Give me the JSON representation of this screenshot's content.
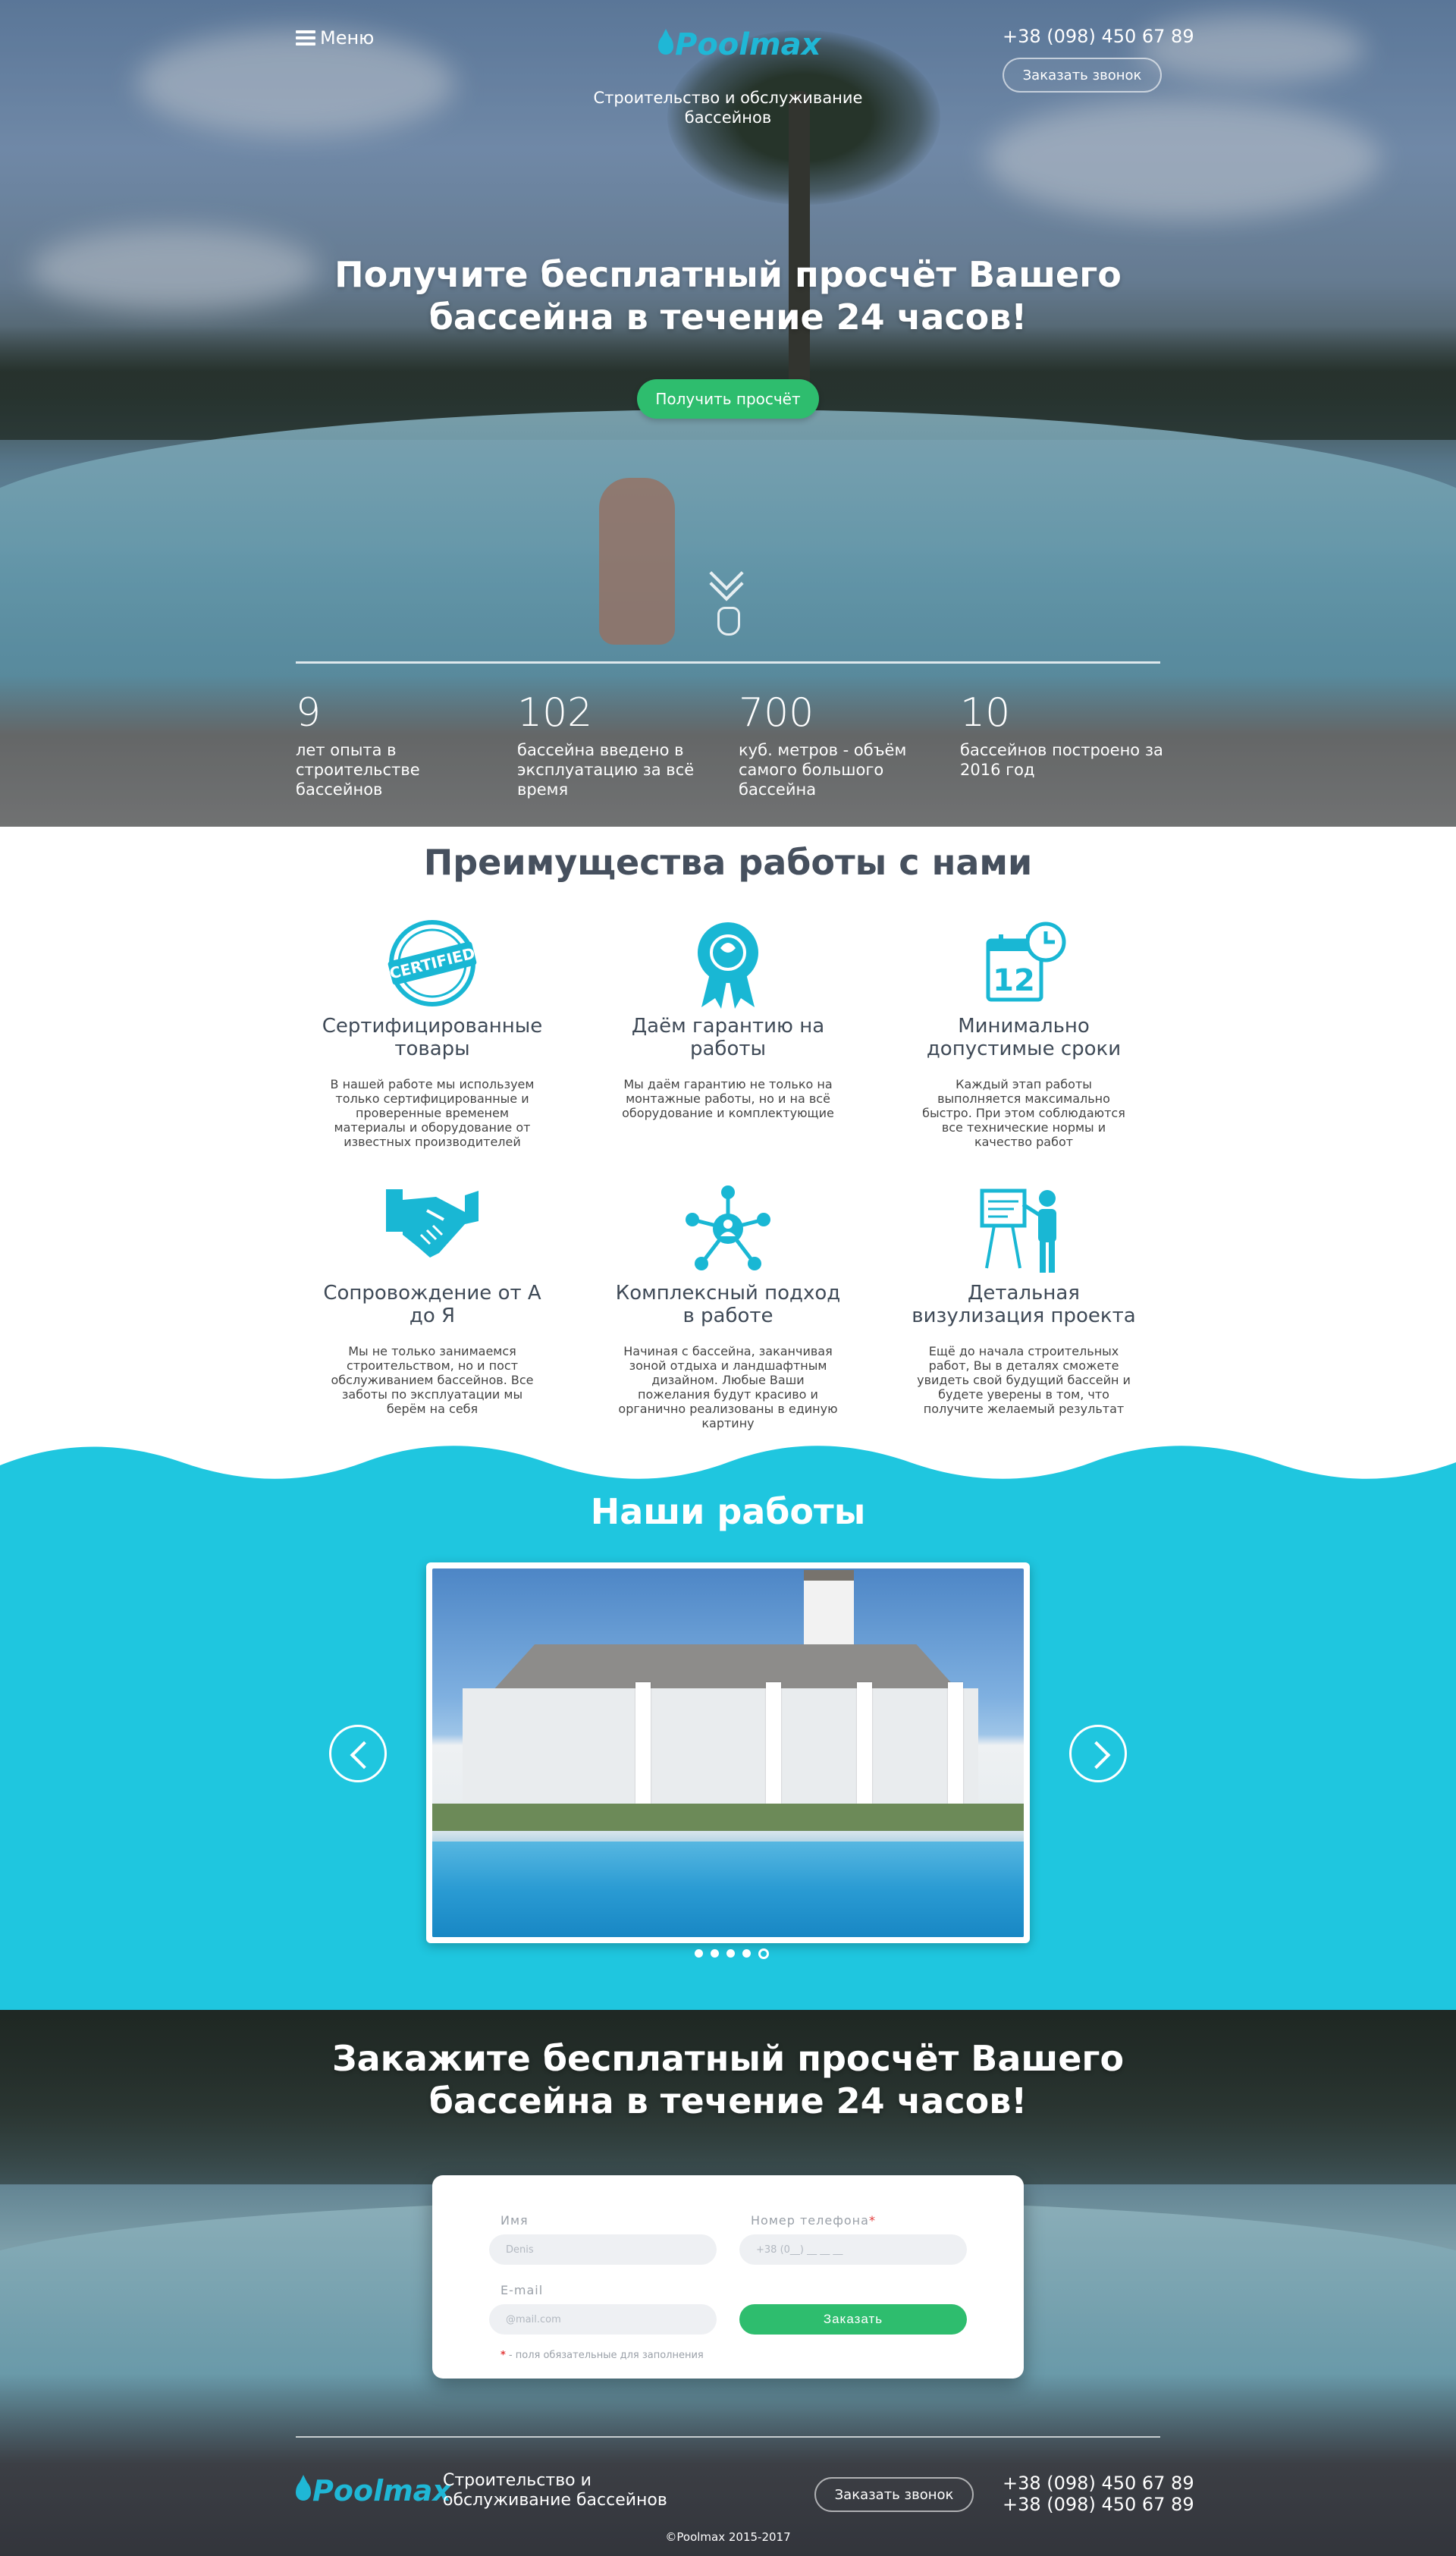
{
  "header": {
    "menu_label": "Меню",
    "logo": "Poolmax",
    "tagline": "Строительство и обслуживание бассейнов",
    "phone": "+38 (098) 450 67 89",
    "callback_label": "Заказать звонок"
  },
  "hero": {
    "title_p1": "Получите ",
    "title_b1": "бесплатный",
    "title_p2": " просчёт Вашего ",
    "title_b2": "бассейна",
    "title_p3": " в течение ",
    "title_b3": "24",
    "title_p4": " часов!",
    "cta_label": "Получить просчёт"
  },
  "stats": [
    {
      "num": "9",
      "label": "лет опыта в строительстве бассейнов"
    },
    {
      "num": "102",
      "label": "бассейна введено в эксплуатацию за всё время"
    },
    {
      "num": "700",
      "label": "куб. метров - объём самого большого бассейна"
    },
    {
      "num": "10",
      "label": "бассейнов построено за 2016 год"
    }
  ],
  "advantages": {
    "title": "Преимущества работы с нами",
    "items": [
      {
        "icon": "certified-icon",
        "title": "Сертифицированные товары",
        "desc": "В нашей работе мы используем только сертифицированные и проверенные временем материалы и оборудование от известных производителей"
      },
      {
        "icon": "award-ribbon-icon",
        "title": "Даём гарантию на работы",
        "desc": "Мы даём гарантию не только на монтажные работы, но и на всё оборудование и комплектующие"
      },
      {
        "icon": "calendar-clock-icon",
        "title": "Минимально допустимые сроки",
        "desc": "Каждый этап работы выполняется максимально быстро. При этом соблюдаются все технические нормы и качество работ"
      },
      {
        "icon": "handshake-icon",
        "title": "Сопровождение от А до Я",
        "desc": "Мы не только занимаемся строительством, но и пост обслуживанием бассейнов. Все заботы по эксплуатации мы берём на себя"
      },
      {
        "icon": "network-icon",
        "title": "Комплексный подход в работе",
        "desc": "Начиная с бассейна, заканчивая зоной отдыха и ландшафтным дизайном. Любые Ваши пожелания будут красиво и органично реализованы в единую картину"
      },
      {
        "icon": "presentation-icon",
        "title": "Детальная визулизация проекта",
        "desc": "Ещё до начала строительных работ, Вы в деталях сможете увидеть свой будущий бассейн и будете уверены в том, что получите желаемый результат"
      }
    ]
  },
  "works": {
    "title": "Наши работы",
    "slide_count": 5,
    "active_slide": 5
  },
  "order": {
    "title_p1": "Закажите ",
    "title_b1": "бесплатный",
    "title_p2": " просчёт Вашего ",
    "title_b2": "бассейна",
    "title_p3": " в течение ",
    "title_b3": "24",
    "title_p4": " часов!",
    "name_label": "Имя",
    "name_placeholder": "Denis",
    "phone_label": "Номер телефона",
    "phone_required": "*",
    "phone_placeholder": "+38 (0__) __ __ __",
    "email_label": "E-mail",
    "email_placeholder": "@mail.com",
    "submit_label": "Заказать",
    "note_star": "*",
    "note_text": " - поля обязательные для заполнения"
  },
  "footer": {
    "logo": "Poolmax",
    "tagline": "Строительство и обслуживание бассейнов",
    "callback_label": "Заказать звонок",
    "phone_1": "+38 (098) 450 67 89",
    "phone_2": "+38 (098) 450 67 89",
    "copyright": "©Poolmax 2015-2017"
  },
  "colors": {
    "accent": "#1fc6df",
    "icon": "#19b7d4",
    "button_green": "#2ebd6e"
  }
}
